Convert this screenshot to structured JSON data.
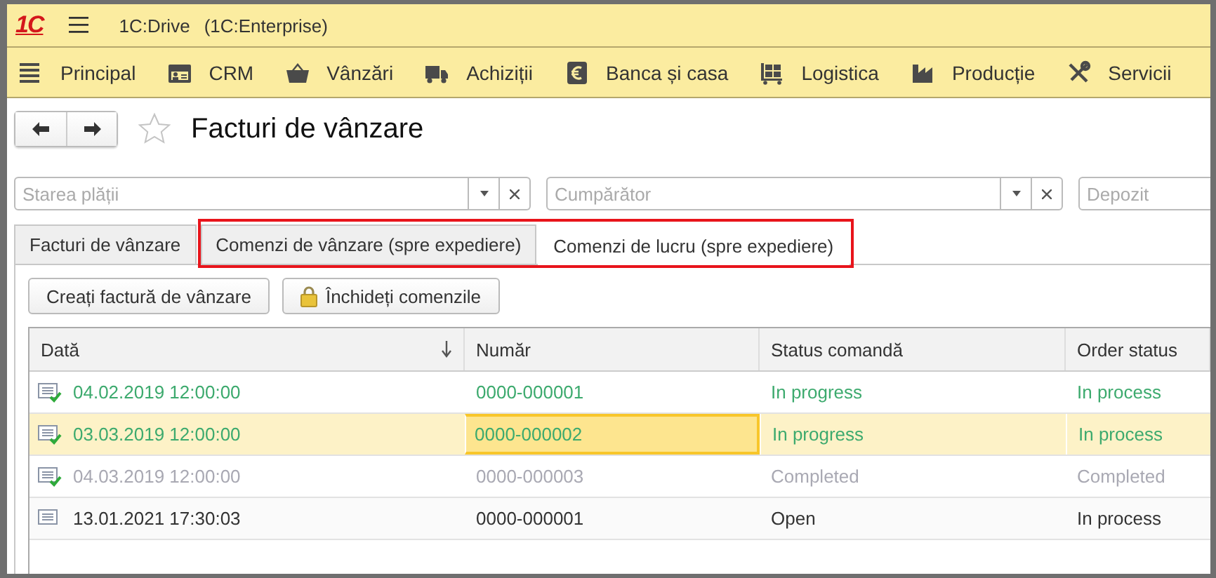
{
  "app": {
    "logo": "1С",
    "title": "1C:Drive",
    "subtitle": "(1C:Enterprise)"
  },
  "menu": [
    {
      "label": "Principal"
    },
    {
      "label": "CRM"
    },
    {
      "label": "Vânzări"
    },
    {
      "label": "Achiziții"
    },
    {
      "label": "Banca și casa"
    },
    {
      "label": "Logistica"
    },
    {
      "label": "Producție"
    },
    {
      "label": "Servicii"
    }
  ],
  "page": {
    "title": "Facturi de vânzare",
    "favorite": false
  },
  "filters": [
    {
      "placeholder": "Starea plății",
      "kind": "combo"
    },
    {
      "placeholder": "Cumpărător",
      "kind": "combo"
    },
    {
      "placeholder": "Depozit",
      "kind": "plain"
    }
  ],
  "tabs": [
    {
      "label": "Facturi de vânzare",
      "selected": false,
      "highlighted": false
    },
    {
      "label": "Comenzi de vânzare (spre expediere)",
      "selected": false,
      "highlighted": true
    },
    {
      "label": "Comenzi de lucru (spre expediere)",
      "selected": true,
      "highlighted": true
    }
  ],
  "actions": [
    {
      "label": "Creați factură de vânzare",
      "kind": "plain"
    },
    {
      "label": "Închideți comenzile",
      "kind": "lock"
    }
  ],
  "table": {
    "columns": [
      {
        "label": "Dată",
        "sorted": true
      },
      {
        "label": "Număr",
        "sorted": false
      },
      {
        "label": "Status comandă",
        "sorted": false
      },
      {
        "label": "Order status",
        "sorted": false
      }
    ],
    "rows": [
      {
        "posted": true,
        "color": "#3daa6e",
        "selected": false,
        "cells": [
          {
            "text": "04.02.2019 12:00:00",
            "focused": false
          },
          {
            "text": "0000-000001",
            "focused": false
          },
          {
            "text": "In progress",
            "focused": false
          },
          {
            "text": "In process",
            "focused": false
          }
        ]
      },
      {
        "posted": true,
        "color": "#3daa6e",
        "selected": true,
        "cells": [
          {
            "text": "03.03.2019 12:00:00",
            "focused": false
          },
          {
            "text": "0000-000002",
            "focused": true
          },
          {
            "text": "In progress",
            "focused": false
          },
          {
            "text": "In process",
            "focused": false
          }
        ]
      },
      {
        "posted": true,
        "color": "#a9a9b3",
        "selected": false,
        "cells": [
          {
            "text": "04.03.2019 12:00:00",
            "focused": false
          },
          {
            "text": "0000-000003",
            "focused": false
          },
          {
            "text": "Completed",
            "focused": false
          },
          {
            "text": "Completed",
            "focused": false
          }
        ]
      },
      {
        "posted": false,
        "color": "#333333",
        "selected": false,
        "cells": [
          {
            "text": "13.01.2021 17:30:03",
            "focused": false
          },
          {
            "text": "0000-000001",
            "focused": false
          },
          {
            "text": "Open",
            "focused": false
          },
          {
            "text": "In process",
            "focused": false
          }
        ]
      }
    ]
  }
}
